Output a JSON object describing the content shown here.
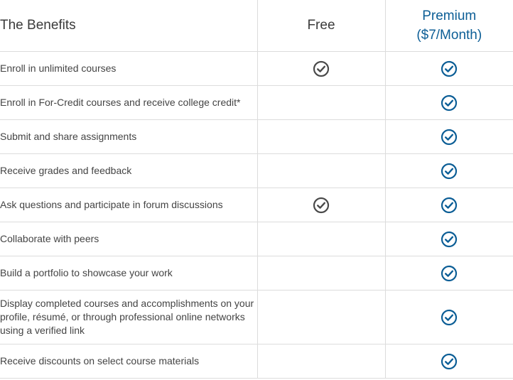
{
  "header": {
    "benefits_label": "The Benefits",
    "free_label": "Free",
    "premium_label": "Premium",
    "premium_price": "($7/Month)"
  },
  "colors": {
    "free_check": "#4a4a4a",
    "premium_check": "#0c5e96",
    "premium_header": "#0c5e96",
    "border": "#dcdcdc"
  },
  "rows": [
    {
      "benefit": "Enroll in unlimited courses",
      "free": true,
      "premium": true
    },
    {
      "benefit": "Enroll in For-Credit courses and receive college credit*",
      "free": false,
      "premium": true
    },
    {
      "benefit": "Submit and share assignments",
      "free": false,
      "premium": true
    },
    {
      "benefit": "Receive grades and feedback",
      "free": false,
      "premium": true
    },
    {
      "benefit": "Ask questions and participate in forum discussions",
      "free": true,
      "premium": true
    },
    {
      "benefit": "Collaborate with peers",
      "free": false,
      "premium": true
    },
    {
      "benefit": "Build a portfolio to showcase your work",
      "free": false,
      "premium": true
    },
    {
      "benefit": "Display completed courses and accomplishments on your profile, résumé, or through professional online networks using a verified link",
      "free": false,
      "premium": true
    },
    {
      "benefit": "Receive discounts on select course materials",
      "free": false,
      "premium": true
    }
  ],
  "icon_names": {
    "check": "check-circle-icon"
  }
}
